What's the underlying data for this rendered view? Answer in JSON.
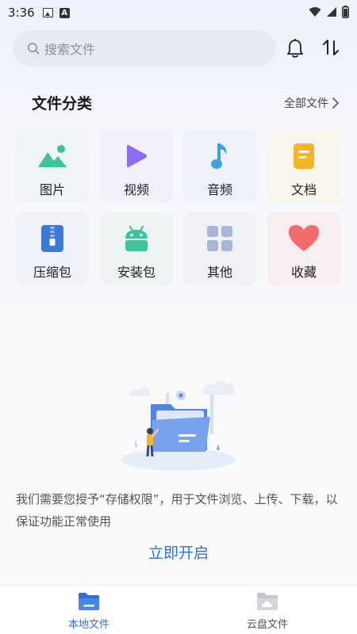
{
  "status_bar": {
    "time": "3:36"
  },
  "search": {
    "placeholder": "搜索文件"
  },
  "section": {
    "title": "文件分类",
    "all_files": "全部文件"
  },
  "categories": [
    {
      "label": "图片",
      "icon": "image-icon",
      "color": "#3ec49a",
      "bg": "#eef4f7"
    },
    {
      "label": "视频",
      "icon": "play-icon",
      "color": "#8b6ef0",
      "bg": "#f1f0fb"
    },
    {
      "label": "音频",
      "icon": "music-note-icon",
      "color": "#3aa0e8",
      "bg": "#eef1f8"
    },
    {
      "label": "文档",
      "icon": "document-icon",
      "color": "#f5b52b",
      "bg": "#f8f5ec"
    },
    {
      "label": "压缩包",
      "icon": "zip-icon",
      "color": "#3f78d6",
      "bg": "#eef1f8"
    },
    {
      "label": "安装包",
      "icon": "android-icon",
      "color": "#3ec49a",
      "bg": "#eef4f3"
    },
    {
      "label": "其他",
      "icon": "grid-icon",
      "color": "#a8b6d8",
      "bg": "#f0f1f6"
    },
    {
      "label": "收藏",
      "icon": "heart-icon",
      "color": "#f26a6a",
      "bg": "#f8eef0"
    }
  ],
  "permission": {
    "message": "我们需要您授予“存储权限”，用于文件浏览、上传、下载，以保证功能正常使用",
    "button": "立即开启"
  },
  "bottom_nav": [
    {
      "label": "本地文件",
      "icon": "folder-icon",
      "active": true,
      "color": "#2f6fd8"
    },
    {
      "label": "云盘文件",
      "icon": "cloud-folder-icon",
      "active": false,
      "color": "#555555"
    }
  ]
}
